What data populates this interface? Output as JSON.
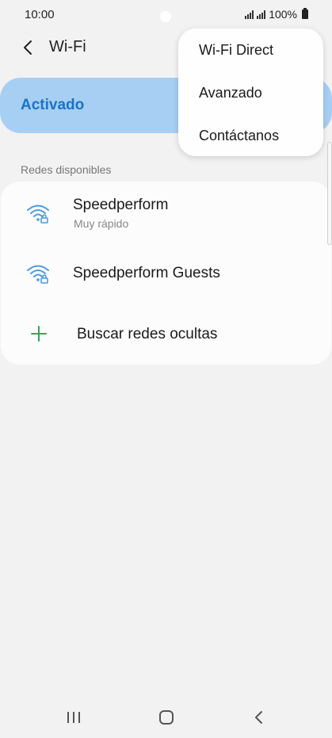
{
  "status_bar": {
    "time": "10:00",
    "battery_percent": "100%"
  },
  "header": {
    "title": "Wi-Fi"
  },
  "wifi_toggle": {
    "label": "Activado",
    "accent_color": "#1a73c9",
    "card_color": "#a7cff3"
  },
  "networks": {
    "section_label": "Redes disponibles",
    "items": [
      {
        "name": "Speedperform",
        "subtitle": "Muy rápido",
        "icon": "wifi-lock-icon"
      },
      {
        "name": "Speedperform Guests",
        "icon": "wifi-lock-icon"
      }
    ],
    "add_hidden": {
      "label": "Buscar redes ocultas",
      "icon": "plus-icon"
    }
  },
  "overflow_menu": {
    "items": [
      {
        "label": "Wi-Fi Direct"
      },
      {
        "label": "Avanzado"
      },
      {
        "label": "Contáctanos"
      }
    ]
  },
  "nav_bar": {
    "icons": [
      "recent-apps-icon",
      "home-icon",
      "back-nav-icon"
    ]
  }
}
